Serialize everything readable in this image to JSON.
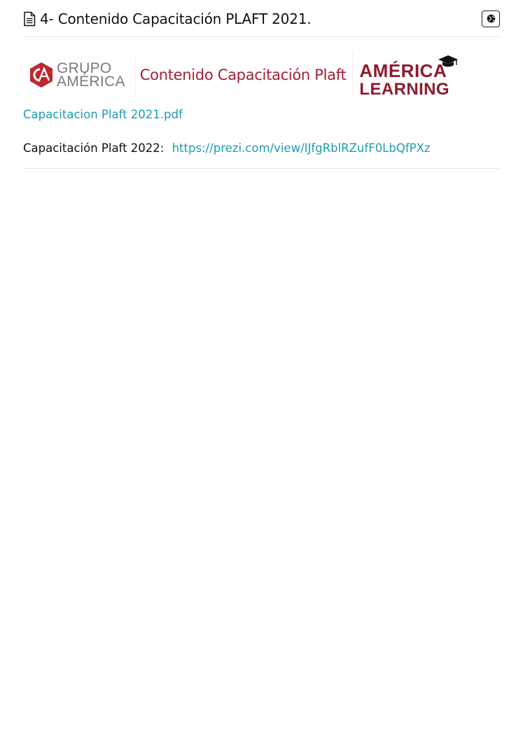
{
  "header": {
    "title": "4- Contenido Capacitación PLAFT 2021.",
    "doc_icon": "document-icon",
    "globe_icon": "globe-icon"
  },
  "banner": {
    "grupo_logo_line1": "GRUPO",
    "grupo_logo_line2": "AMÉRICA",
    "title": "Contenido Capacitación Plaft",
    "america_logo_line1": "AMÉRICA",
    "america_logo_line2": "LEARNING",
    "brand_color": "#a3203a",
    "logo_red": "#c0282e"
  },
  "content": {
    "pdf_link_text": "Capacitacion Plaft 2021.pdf",
    "prezi_label": "Capacitación Plaft 2022:",
    "prezi_url": "https://prezi.com/view/IJfgRblRZufF0LbQfPXz",
    "link_color": "#1e9bb0"
  }
}
